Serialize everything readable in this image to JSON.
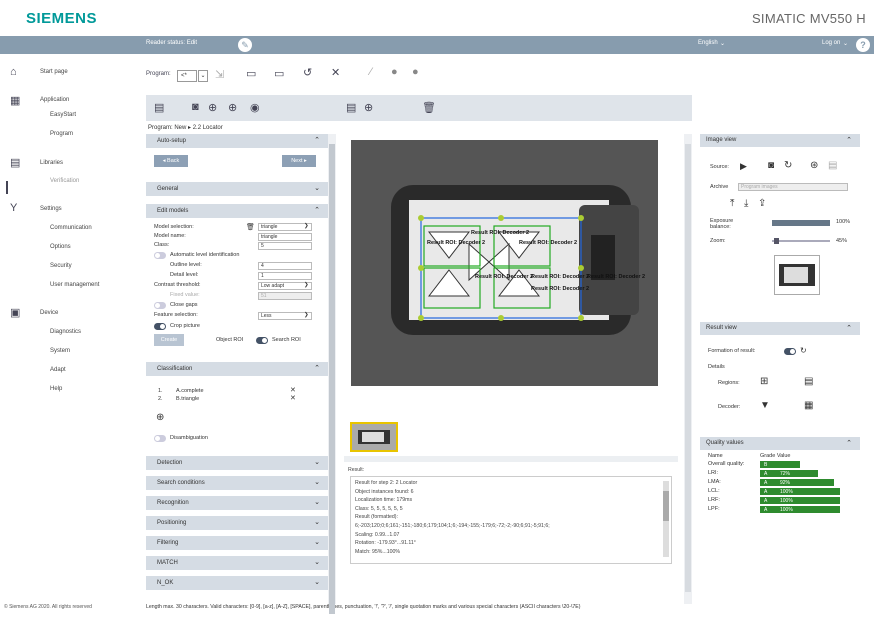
{
  "header": {
    "logo": "SIEMENS",
    "product": "SIMATIC MV550 H"
  },
  "topbar": {
    "reader_status": "Reader status: Edit",
    "language": "English",
    "language_chevron": "⌄",
    "login": "Log on",
    "login_chevron": "⌄"
  },
  "nav": {
    "start_page": "Start page",
    "application": "Application",
    "easystart": "EasyStart",
    "program": "Program",
    "libraries": "Libraries",
    "verification": "Verification",
    "settings": "Settings",
    "communication": "Communication",
    "options": "Options",
    "security": "Security",
    "user_management": "User management",
    "device": "Device",
    "diagnostics": "Diagnostics",
    "system": "System",
    "adapt": "Adapt",
    "help": "Help",
    "copyright": "© Siemens AG 2020. All rights reserved"
  },
  "toolbar": {
    "program_label": "Program:",
    "program_value": "<*",
    "program_chevron": "⌄"
  },
  "breadcrumb": "Program: New ▸ 2.2 Locator",
  "left": {
    "auto_setup": "Auto-setup",
    "back": "◂ Back",
    "next": "Next ▸",
    "general": "General",
    "edit_models": "Edit models",
    "model_selection_label": "Model selection:",
    "model_selection_value": "triangle",
    "model_name_label": "Model name:",
    "model_name_value": "triangle",
    "class_label": "Class:",
    "class_value": "5",
    "auto_level": "Automatic level identification",
    "outline_label": "Outline level:",
    "outline_value": "4",
    "detail_label": "Detail level:",
    "detail_value": "1",
    "contrast_label": "Contrast threshold:",
    "contrast_value": "Low adapt",
    "fixed_label": "Fixed value:",
    "fixed_value": "51",
    "close_gaps": "Close gaps",
    "feature_label": "Feature selection:",
    "feature_value": "Less",
    "crop": "Crop picture",
    "create": "Create",
    "object_roi": "Object ROI",
    "search_roi": "Search ROI",
    "classification": "Classification",
    "class_items": [
      {
        "num": "1.",
        "name": "A.complete"
      },
      {
        "num": "2.",
        "name": "B.triangle"
      }
    ],
    "disambiguation": "Disambiguation",
    "detection": "Detection",
    "search_conditions": "Search conditions",
    "recognition": "Recognition",
    "positioning": "Positioning",
    "filtering": "Filtering",
    "match": "MATCH",
    "n_ok": "N_OK",
    "chev_down": "⌄",
    "chev_up": "⌃",
    "dropdown": "❯"
  },
  "image": {
    "roi_labels": [
      "Result ROI: Decoder 2",
      "Result ROI: Decoder 2",
      "Result ROI: Decoder 2",
      "Result ROI: Decoder 2",
      "Result ROI: Decoder 2",
      "Result ROI: Decoder 2",
      "Result ROI: Decoder 2"
    ]
  },
  "result": {
    "title": "Result:",
    "lines": [
      "Result for step 2: 2 Locator",
      "Object instances found: 6",
      "Localization time: 179ms",
      "Class: 5, 5, 5, 5, 5, 5",
      "Result (formatted):",
      "6;-203;120;0;6;161;-151;-180;6;179;104;1;6;-194;-155;-179;6;-72;-2;-90;6;91;-5;91;6;",
      "Scaling: 0.99...1.07",
      "Rotation: -179.93°...91.11°",
      "Match: 95%...100%"
    ]
  },
  "right": {
    "image_view": "Image view",
    "source": "Source:",
    "archive": "Archive",
    "archive_value": "Program images",
    "exposure": "Exposure balance:",
    "exposure_value": "100%",
    "zoom": "Zoom:",
    "zoom_value": "45%",
    "result_view": "Result view",
    "formation": "Formation of result:",
    "details": "Details",
    "regions": "Regions:",
    "decoder": "Decoder:",
    "quality_values": "Quality values",
    "q_name": "Name",
    "q_grade": "Grade Value",
    "quality": [
      {
        "name": "Overall quality:",
        "grade": "B",
        "value": "",
        "fill": 0.5
      },
      {
        "name": "LRI:",
        "grade": "A",
        "value": "72%",
        "fill": 0.72
      },
      {
        "name": "LMA:",
        "grade": "A",
        "value": "92%",
        "fill": 0.92
      },
      {
        "name": "LCL:",
        "grade": "A",
        "value": "100%",
        "fill": 1.0
      },
      {
        "name": "LRF:",
        "grade": "A",
        "value": "100%",
        "fill": 1.0
      },
      {
        "name": "LPF:",
        "grade": "A",
        "value": "100%",
        "fill": 1.0
      }
    ]
  },
  "footer_hint": "Length max. 30 characters. Valid characters: [0-9], [a-z], [A-Z], [SPACE], parentheses, punctuation, '!', '?', '/', single quotation marks and various special characters (ASCII characters \\20-\\7E)"
}
